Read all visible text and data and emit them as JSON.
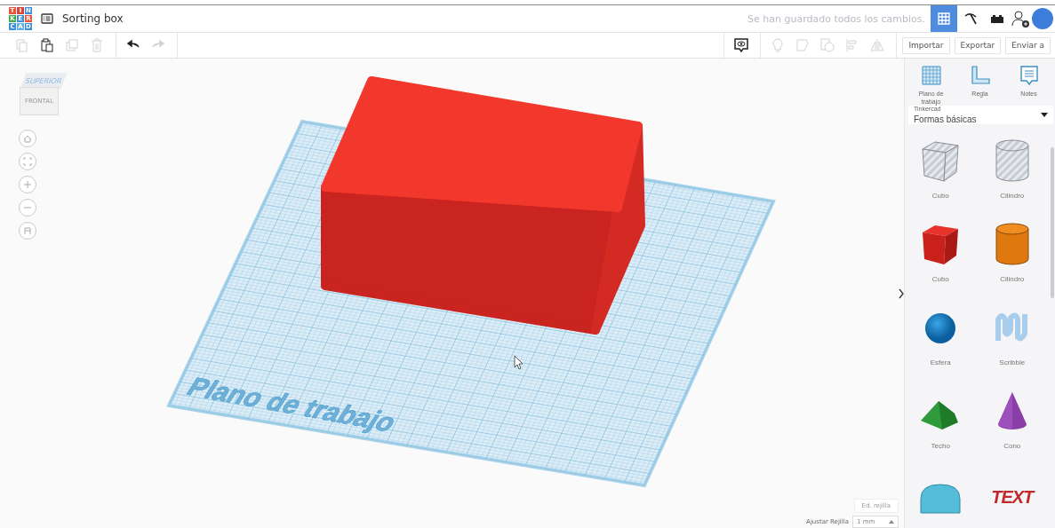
{
  "header": {
    "logo_letters": [
      "T",
      "I",
      "N",
      "K",
      "E",
      "R",
      "C",
      "A",
      "D"
    ],
    "title": "Sorting box",
    "save_status": "Se han guardado todos los cambios.",
    "view_buttons": [
      {
        "kind": "grid",
        "selected": true
      },
      {
        "kind": "pickaxe",
        "selected": false
      },
      {
        "kind": "brick",
        "selected": false
      }
    ]
  },
  "toolbar": {
    "left_tools": [
      {
        "kind": "copy",
        "disabled": true
      },
      {
        "kind": "paste",
        "disabled": false
      },
      {
        "kind": "duplicate",
        "disabled": true
      },
      {
        "kind": "delete",
        "disabled": true
      },
      {
        "kind": "undo",
        "disabled": false
      },
      {
        "kind": "redo",
        "disabled": true
      }
    ],
    "right_tools": [
      {
        "kind": "notes-view",
        "disabled": false
      },
      {
        "kind": "bulb",
        "disabled": true
      },
      {
        "kind": "group",
        "disabled": true
      },
      {
        "kind": "ungroup",
        "disabled": true
      },
      {
        "kind": "align",
        "disabled": true
      },
      {
        "kind": "mirror",
        "disabled": true
      }
    ],
    "actions": [
      "Importar",
      "Exportar",
      "Enviar a"
    ]
  },
  "view_cube": {
    "top": "SUPERIOR",
    "front": "FRONTAL"
  },
  "nav_controls": [
    {
      "kind": "home"
    },
    {
      "kind": "fit"
    },
    {
      "kind": "zoom-in"
    },
    {
      "kind": "zoom-out"
    },
    {
      "kind": "perspective"
    }
  ],
  "workplane": {
    "label": "Plano de trabajo"
  },
  "panel": {
    "tools": [
      {
        "kind": "workplane",
        "label": "Plano de trabajo"
      },
      {
        "kind": "ruler",
        "label": "Regla"
      },
      {
        "kind": "notes",
        "label": "Notes"
      }
    ],
    "category": {
      "source": "Tinkercad",
      "value": "Formas básicas"
    },
    "shapes": [
      {
        "kind": "cube-hole",
        "label": "Cubo"
      },
      {
        "kind": "cylinder-hole",
        "label": "Cilindro"
      },
      {
        "kind": "cube",
        "label": "Cubo"
      },
      {
        "kind": "cylinder",
        "label": "Cilindro"
      },
      {
        "kind": "sphere",
        "label": "Esfera"
      },
      {
        "kind": "scribble",
        "label": "Scribble"
      },
      {
        "kind": "roof",
        "label": "Techo"
      },
      {
        "kind": "cone",
        "label": "Cono"
      },
      {
        "kind": "half-cylinder"
      },
      {
        "kind": "text",
        "art_text": "TEXT"
      }
    ]
  },
  "grid": {
    "edit_button": "Ed. rejilla",
    "snap_label": "Ajustar Rejilla",
    "snap_value": "1 mm"
  }
}
